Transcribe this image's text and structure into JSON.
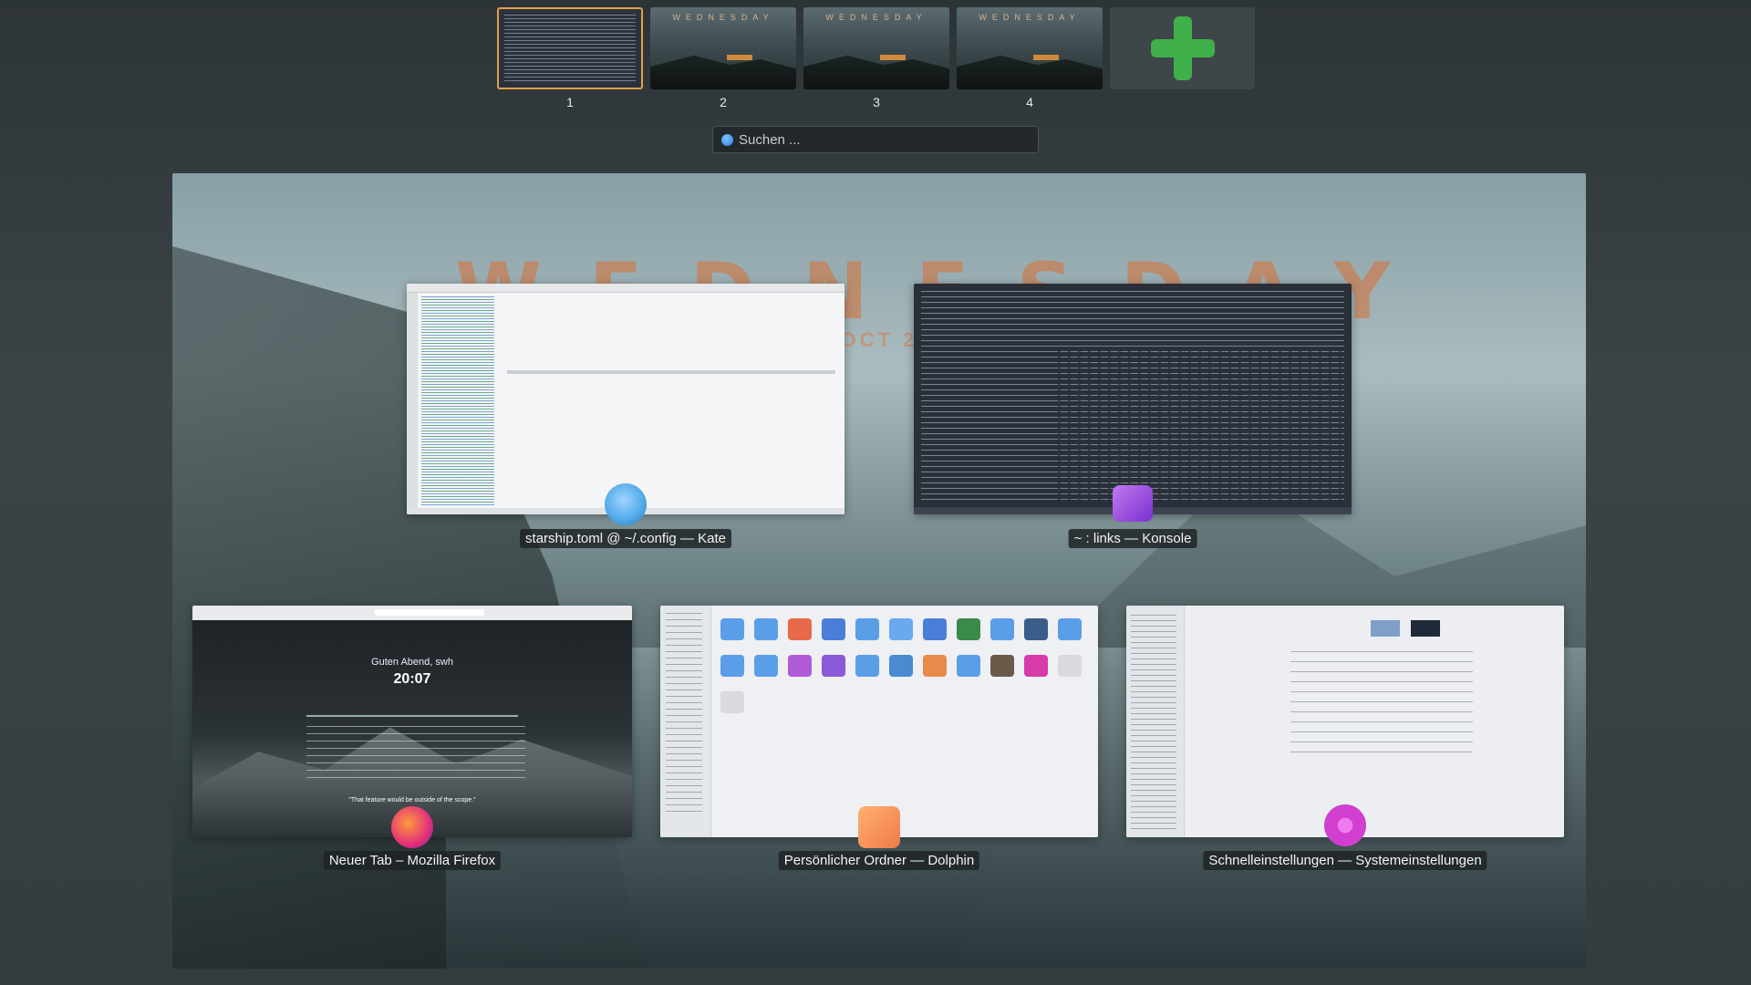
{
  "desktops": [
    {
      "number": "1",
      "active": true
    },
    {
      "number": "2",
      "active": false
    },
    {
      "number": "3",
      "active": false
    },
    {
      "number": "4",
      "active": false
    }
  ],
  "wallpaper": {
    "title": "WEDNESDAY",
    "date": "16 OCT 20"
  },
  "search": {
    "placeholder": "Suchen ..."
  },
  "windows": {
    "kate": {
      "title": "starship.toml @ ~/.config — Kate"
    },
    "konsole": {
      "title": "~ : links — Konsole"
    },
    "firefox": {
      "title": "Neuer Tab – Mozilla Firefox",
      "greeting": "Guten Abend, swh",
      "time": "20:07",
      "quote": "\"That feature would be outside of the scope.\""
    },
    "dolphin": {
      "title": "Persönlicher Ordner — Dolphin"
    },
    "systemsettings": {
      "title": "Schnelleinstellungen — Systemeinstellungen"
    }
  },
  "colors": {
    "active_border": "#e3a04a",
    "add_desktop": "#3fb04a",
    "kate_icon": "#4fa8e8",
    "konsole_icon": "#a24fe0",
    "firefox_icon": "#e3307a",
    "dolphin_icon": "#f07a4a",
    "settings_icon": "#d23fd0"
  }
}
